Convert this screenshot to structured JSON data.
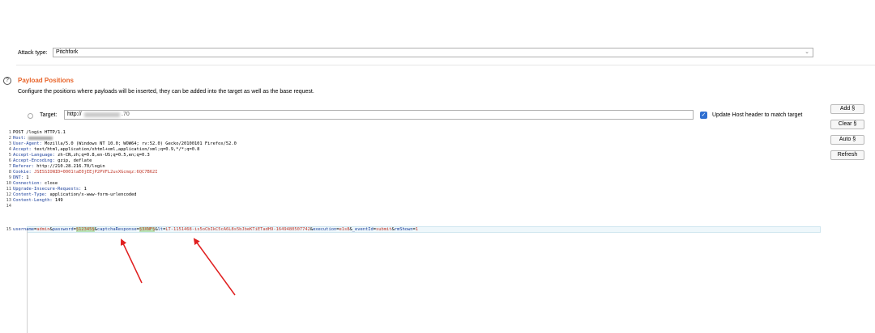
{
  "attack": {
    "label": "Attack type:",
    "value": "Pitchfork"
  },
  "section": {
    "title": "Payload Positions",
    "description": "Configure the positions where payloads will be inserted, they can be added into the target as well as the base request."
  },
  "target": {
    "label": "Target:",
    "value_visible": "http://",
    "value_tail": ".70"
  },
  "update_host": {
    "label": "Update Host header to match target",
    "checked": true
  },
  "buttons": {
    "add": "Add §",
    "clear": "Clear §",
    "auto": "Auto §",
    "refresh": "Refresh"
  },
  "request": {
    "line1": "POST /login HTTP/1.1",
    "host_name": "Host:",
    "ua_name": "User-Agent:",
    "ua_value": " Mozilla/5.0 (Windows NT 10.0; WOW64; rv:52.0) Gecko/20100101 Firefox/52.0",
    "accept_name": "Accept:",
    "accept_value": " text/html,application/xhtml+xml,application/xml;q=0.9,*/*;q=0.8",
    "lang_name": "Accept-Language:",
    "lang_value": " zh-CN,zh;q=0.8,en-US;q=0.5,en;q=0.3",
    "enc_name": "Accept-Encoding:",
    "enc_value": " gzip, deflate",
    "ref_name": "Referer:",
    "ref_value": " http://210.28.216.70/login",
    "cookie_name": "Cookie:",
    "cookie_value": " JSESSIONID=0001taE0jEEjP2PVFL2uvXGcmqz:6QC7B62I",
    "dnt_name": "DNT:",
    "dnt_value": " 1",
    "conn_name": "Connection:",
    "conn_value": " close",
    "uir_name": "Upgrade-Insecure-Requests:",
    "uir_value": " 1",
    "ct_name": "Content-Type:",
    "ct_value": " application/x-www-form-urlencoded",
    "cl_name": "Content-Length:",
    "cl_value": " 149",
    "body": {
      "p1n": "username",
      "p1v": "admin",
      "p2n": "password",
      "p2v": "§12345§",
      "p3n": "captchaResponse",
      "p3v": "§3XNF§",
      "p4n": "lt",
      "p4v": "LT-1151468-is5oCbIkC5cA6L8s5bJbeKTiETadH9-1649480507742",
      "p5n": "execution",
      "p5v": "e1s8",
      "p6n": "_eventId",
      "p6v": "submit",
      "p7n": "rmShown",
      "p7v": "1"
    }
  },
  "line_numbers": [
    "1",
    "2",
    "3",
    "4",
    "5",
    "6",
    "7",
    "8",
    "9",
    "10",
    "11",
    "12",
    "13",
    "14",
    "15"
  ],
  "colors": {
    "accent": "#e8642a",
    "arrow": "#e02020",
    "checkbox": "#2f6fd1"
  }
}
